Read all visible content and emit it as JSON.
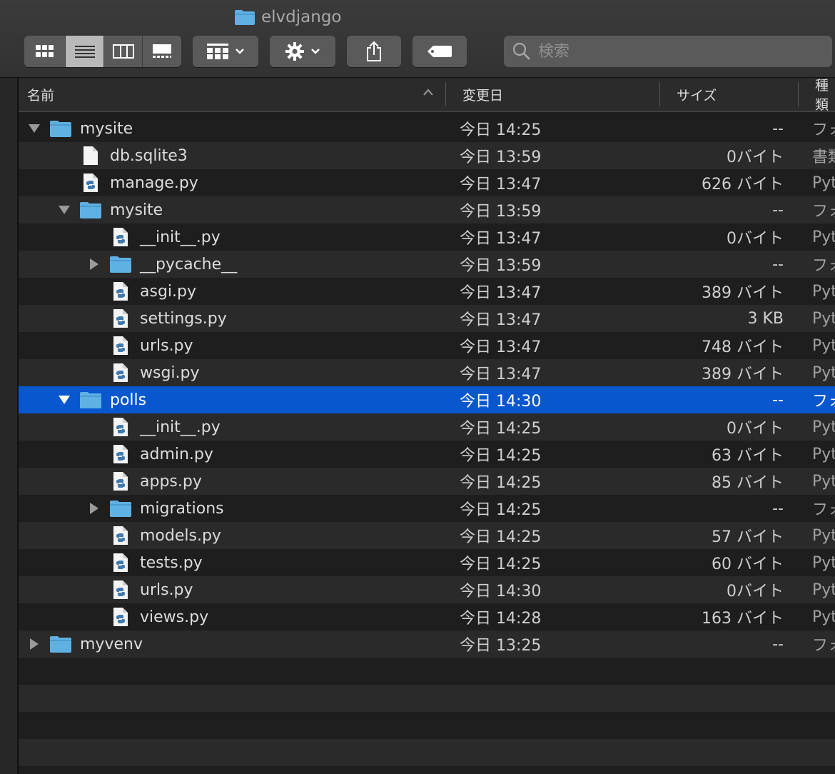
{
  "window": {
    "title": "elvdjango"
  },
  "toolbar": {
    "view_modes": [
      "icon-view",
      "list-view",
      "column-view",
      "gallery-view"
    ],
    "active_view": "list-view",
    "search_placeholder": "検索"
  },
  "columns": {
    "name": "名前",
    "date": "変更日",
    "size": "サイズ",
    "kind": "種類"
  },
  "rows": [
    {
      "name": "mysite",
      "type": "folder",
      "depth": 0,
      "disclosure": "open",
      "date": "今日 14:25",
      "size": "--",
      "kind": "フォルダ"
    },
    {
      "name": "db.sqlite3",
      "type": "file",
      "depth": 1,
      "disclosure": "none",
      "date": "今日 13:59",
      "size": "0バイト",
      "kind": "書類"
    },
    {
      "name": "manage.py",
      "type": "python",
      "depth": 1,
      "disclosure": "none",
      "date": "今日 13:47",
      "size": "626 バイト",
      "kind": "Python"
    },
    {
      "name": "mysite",
      "type": "folder",
      "depth": 1,
      "disclosure": "open",
      "date": "今日 13:59",
      "size": "--",
      "kind": "フォルダ"
    },
    {
      "name": "__init__.py",
      "type": "python",
      "depth": 2,
      "disclosure": "none",
      "date": "今日 13:47",
      "size": "0バイト",
      "kind": "Python"
    },
    {
      "name": "__pycache__",
      "type": "folder",
      "depth": 2,
      "disclosure": "closed",
      "date": "今日 13:59",
      "size": "--",
      "kind": "フォルダ"
    },
    {
      "name": "asgi.py",
      "type": "python",
      "depth": 2,
      "disclosure": "none",
      "date": "今日 13:47",
      "size": "389 バイト",
      "kind": "Python"
    },
    {
      "name": "settings.py",
      "type": "python",
      "depth": 2,
      "disclosure": "none",
      "date": "今日 13:47",
      "size": "3 KB",
      "kind": "Python"
    },
    {
      "name": "urls.py",
      "type": "python",
      "depth": 2,
      "disclosure": "none",
      "date": "今日 13:47",
      "size": "748 バイト",
      "kind": "Python"
    },
    {
      "name": "wsgi.py",
      "type": "python",
      "depth": 2,
      "disclosure": "none",
      "date": "今日 13:47",
      "size": "389 バイト",
      "kind": "Python"
    },
    {
      "name": "polls",
      "type": "folder",
      "depth": 1,
      "disclosure": "open",
      "date": "今日 14:30",
      "size": "--",
      "kind": "フォルダ",
      "selected": true
    },
    {
      "name": "__init__.py",
      "type": "python",
      "depth": 2,
      "disclosure": "none",
      "date": "今日 14:25",
      "size": "0バイト",
      "kind": "Python"
    },
    {
      "name": "admin.py",
      "type": "python",
      "depth": 2,
      "disclosure": "none",
      "date": "今日 14:25",
      "size": "63 バイト",
      "kind": "Python"
    },
    {
      "name": "apps.py",
      "type": "python",
      "depth": 2,
      "disclosure": "none",
      "date": "今日 14:25",
      "size": "85 バイト",
      "kind": "Python"
    },
    {
      "name": "migrations",
      "type": "folder",
      "depth": 2,
      "disclosure": "closed",
      "date": "今日 14:25",
      "size": "--",
      "kind": "フォルダ"
    },
    {
      "name": "models.py",
      "type": "python",
      "depth": 2,
      "disclosure": "none",
      "date": "今日 14:25",
      "size": "57 バイト",
      "kind": "Python"
    },
    {
      "name": "tests.py",
      "type": "python",
      "depth": 2,
      "disclosure": "none",
      "date": "今日 14:25",
      "size": "60 バイト",
      "kind": "Python"
    },
    {
      "name": "urls.py",
      "type": "python",
      "depth": 2,
      "disclosure": "none",
      "date": "今日 14:30",
      "size": "0バイト",
      "kind": "Python"
    },
    {
      "name": "views.py",
      "type": "python",
      "depth": 2,
      "disclosure": "none",
      "date": "今日 14:28",
      "size": "163 バイト",
      "kind": "Python"
    },
    {
      "name": "myvenv",
      "type": "folder",
      "depth": 0,
      "disclosure": "closed",
      "date": "今日 13:25",
      "size": "--",
      "kind": "フォルダ"
    }
  ],
  "colors": {
    "selection": "#0857cf",
    "folder": "#5fb0e3",
    "row_alt": "#2a2a2a"
  }
}
